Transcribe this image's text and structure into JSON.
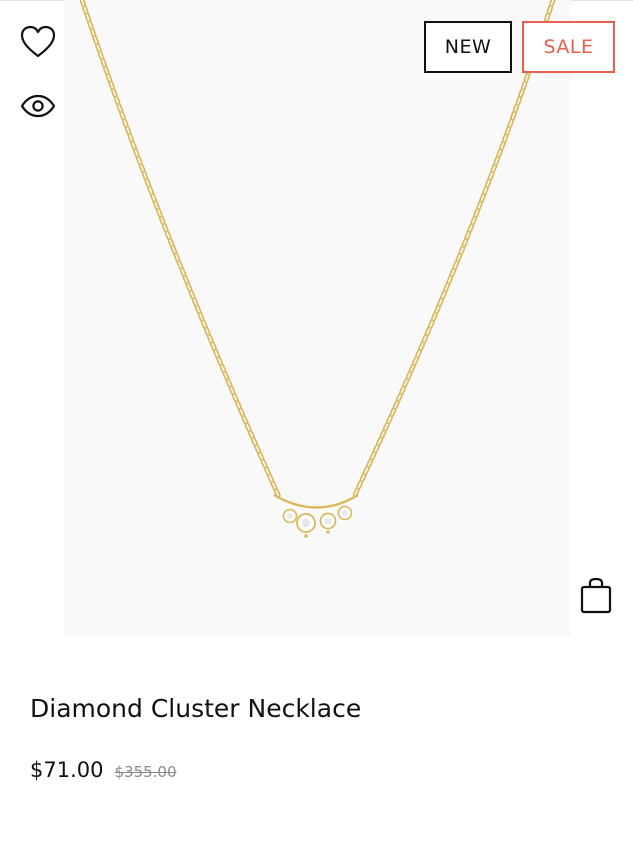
{
  "product": {
    "title": "Diamond Cluster Necklace",
    "price": "$71.00",
    "original_price": "$355.00"
  },
  "badges": {
    "new": "NEW",
    "sale": "SALE"
  },
  "icons": {
    "wishlist": "heart-icon",
    "quick_view": "eye-icon",
    "add_to_bag": "shopping-bag-icon"
  },
  "colors": {
    "sale_accent": "#e8604c",
    "image_background": "#f9f9f9",
    "chain_gold": "#d9b85c"
  }
}
